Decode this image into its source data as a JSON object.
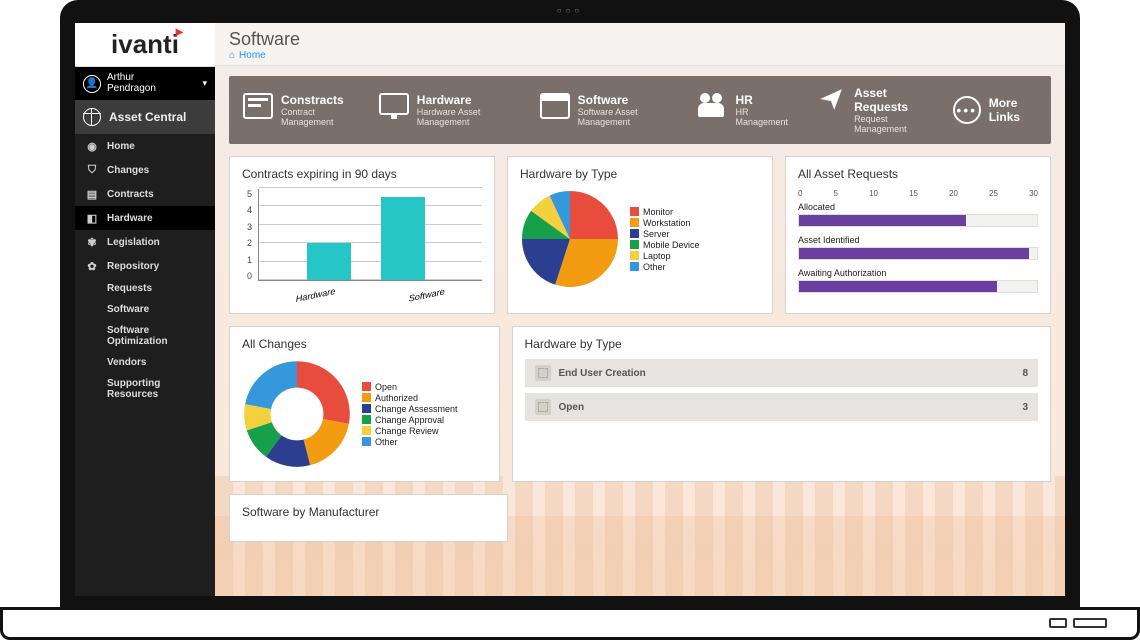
{
  "brand": "ivanti",
  "user": {
    "name": "Arthur\nPendragon"
  },
  "asset_central_label": "Asset Central",
  "sidebar": {
    "items": [
      {
        "label": "Home"
      },
      {
        "label": "Changes"
      },
      {
        "label": "Contracts"
      },
      {
        "label": "Hardware"
      },
      {
        "label": "Legislation"
      },
      {
        "label": "Repository"
      },
      {
        "label": "Requests"
      },
      {
        "label": "Software"
      },
      {
        "label": "Software Optimization"
      },
      {
        "label": "Vendors"
      },
      {
        "label": "Supporting Resources"
      }
    ],
    "active_index": 3
  },
  "header": {
    "title": "Software",
    "breadcrumb": "Home"
  },
  "linkbar": [
    {
      "title": "Constracts",
      "sub": "Contract Management",
      "icon": "docs"
    },
    {
      "title": "Hardware",
      "sub": "Hardware Asset Management",
      "icon": "monitor"
    },
    {
      "title": "Software",
      "sub": "Software Asset Management",
      "icon": "window"
    },
    {
      "title": "HR",
      "sub": "HR Management",
      "icon": "people"
    },
    {
      "title": "Asset Requests",
      "sub": "Request Management",
      "icon": "plane"
    },
    {
      "title": "More Links",
      "sub": "",
      "icon": "more"
    }
  ],
  "cards": {
    "contracts_expiring": {
      "title": "Contracts expiring in 90 days"
    },
    "hardware_by_type_pie": {
      "title": "Hardware by Type"
    },
    "asset_requests": {
      "title": "All Asset Requests"
    },
    "all_changes": {
      "title": "All Changes"
    },
    "hardware_by_type_list": {
      "title": "Hardware by Type"
    },
    "software_by_manufacturer": {
      "title": "Software by Manufacturer"
    }
  },
  "chart_data": [
    {
      "id": "contracts_expiring",
      "type": "bar",
      "categories": [
        "Hardware",
        "Software"
      ],
      "values": [
        2,
        4.5
      ],
      "ylim": [
        0,
        5
      ],
      "yticks": [
        0,
        1,
        2,
        3,
        4,
        5
      ],
      "color": "#26c6c6"
    },
    {
      "id": "hardware_by_type_pie",
      "type": "pie",
      "series": [
        {
          "name": "Monitor",
          "value": 25,
          "color": "#e84c3d"
        },
        {
          "name": "Workstation",
          "value": 30,
          "color": "#f39c12"
        },
        {
          "name": "Server",
          "value": 20,
          "color": "#2c3e8f"
        },
        {
          "name": "Mobile Device",
          "value": 10,
          "color": "#16a04a"
        },
        {
          "name": "Laptop",
          "value": 8,
          "color": "#f4d03f"
        },
        {
          "name": "Other",
          "value": 7,
          "color": "#3498db"
        }
      ]
    },
    {
      "id": "asset_requests",
      "type": "bar",
      "orientation": "horizontal",
      "xlim": [
        0,
        30
      ],
      "xticks": [
        0,
        5,
        10,
        15,
        20,
        25,
        30
      ],
      "series": [
        {
          "name": "Allocated",
          "value": 21
        },
        {
          "name": "Asset Identified",
          "value": 29
        },
        {
          "name": "Awaiting Authorization",
          "value": 25
        }
      ],
      "color": "#6b3fa0"
    },
    {
      "id": "all_changes",
      "type": "pie",
      "donut": true,
      "series": [
        {
          "name": "Open",
          "value": 28,
          "color": "#e84c3d"
        },
        {
          "name": "Authorized",
          "value": 18,
          "color": "#f39c12"
        },
        {
          "name": "Change Assessment",
          "value": 14,
          "color": "#2c3e8f"
        },
        {
          "name": "Change Approval",
          "value": 10,
          "color": "#16a04a"
        },
        {
          "name": "Change Review",
          "value": 8,
          "color": "#f4d03f"
        },
        {
          "name": "Other",
          "value": 22,
          "color": "#3498db"
        }
      ]
    },
    {
      "id": "hardware_by_type_list",
      "type": "table",
      "rows": [
        {
          "label": "End User Creation",
          "count": 8
        },
        {
          "label": "Open",
          "count": 3
        }
      ]
    }
  ]
}
